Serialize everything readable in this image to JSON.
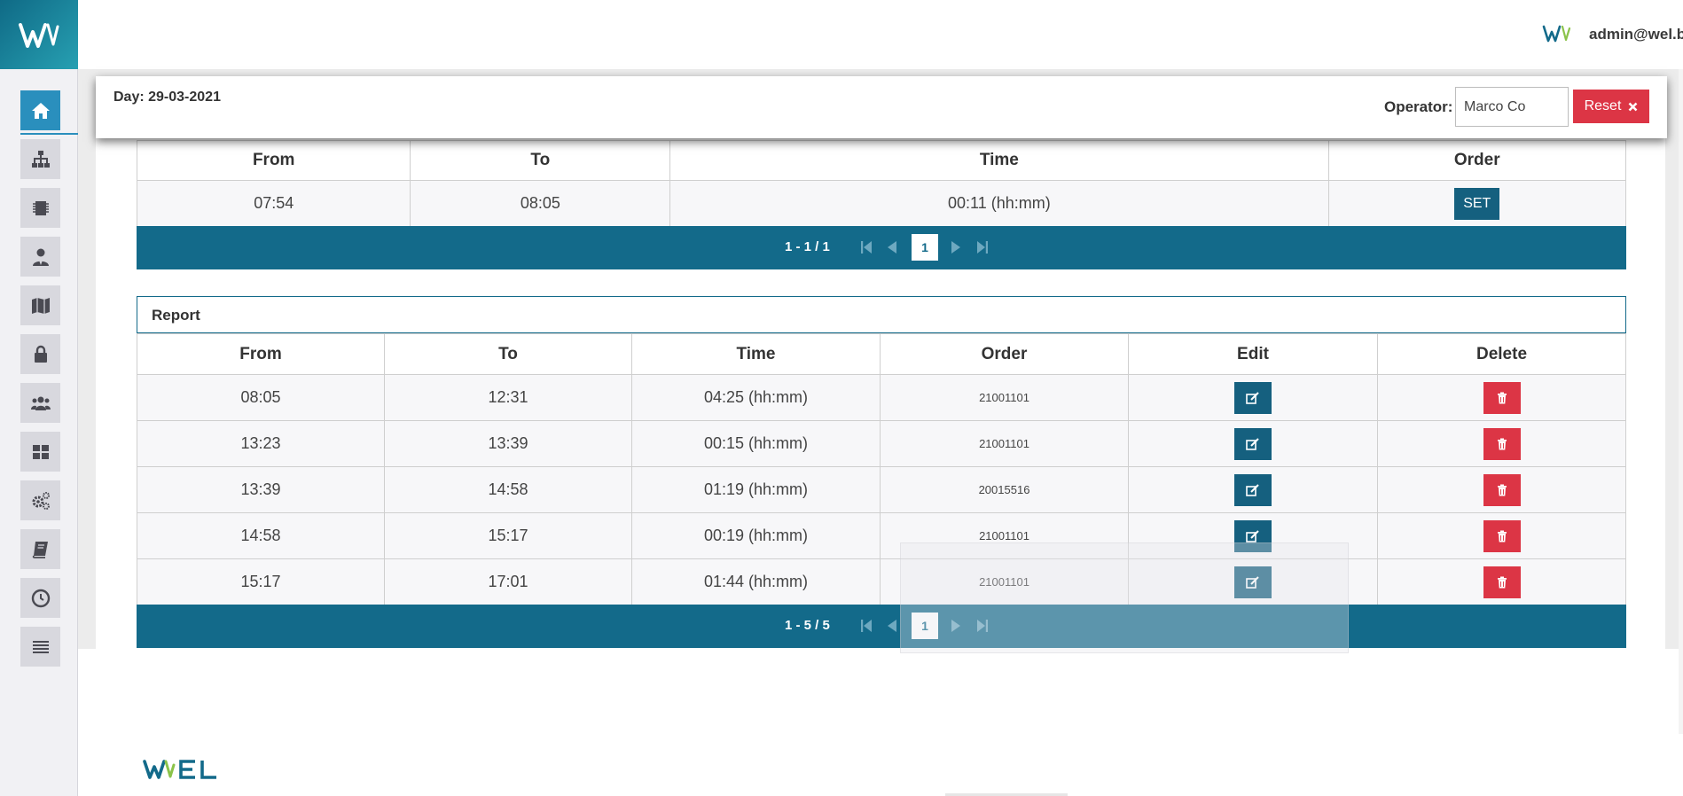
{
  "header": {
    "user_email": "admin@wel.business"
  },
  "sidebar": {
    "items": [
      {
        "name": "home",
        "icon": "home-icon"
      },
      {
        "name": "structure",
        "icon": "sitemap-icon"
      },
      {
        "name": "device",
        "icon": "chip-icon"
      },
      {
        "name": "operator",
        "icon": "user-tie-icon"
      },
      {
        "name": "map",
        "icon": "map-icon"
      },
      {
        "name": "security",
        "icon": "lock-icon"
      },
      {
        "name": "users",
        "icon": "users-icon"
      },
      {
        "name": "dashboard",
        "icon": "grid-icon"
      },
      {
        "name": "settings",
        "icon": "gears-icon"
      },
      {
        "name": "book",
        "icon": "book-icon"
      },
      {
        "name": "history",
        "icon": "clock-icon"
      },
      {
        "name": "list",
        "icon": "bars-icon"
      }
    ]
  },
  "filter": {
    "day_label": "Day: 29-03-2021",
    "operator_label": "Operator:",
    "operator_value": "Marco Co",
    "reset_label": "Reset"
  },
  "current_table": {
    "headers": [
      "From",
      "To",
      "Time",
      "Order"
    ],
    "rows": [
      {
        "from": "07:54",
        "to": "08:05",
        "time": "00:11 (hh:mm)",
        "order_button": "SET"
      }
    ],
    "pager": {
      "range": "1 - 1 / 1",
      "page": "1"
    }
  },
  "report": {
    "title": "Report",
    "headers": [
      "From",
      "To",
      "Time",
      "Order",
      "Edit",
      "Delete"
    ],
    "rows": [
      {
        "from": "08:05",
        "to": "12:31",
        "time": "04:25 (hh:mm)",
        "order": "21001101"
      },
      {
        "from": "13:23",
        "to": "13:39",
        "time": "00:15 (hh:mm)",
        "order": "21001101"
      },
      {
        "from": "13:39",
        "to": "14:58",
        "time": "01:19 (hh:mm)",
        "order": "20015516"
      },
      {
        "from": "14:58",
        "to": "15:17",
        "time": "00:19 (hh:mm)",
        "order": "21001101"
      },
      {
        "from": "15:17",
        "to": "17:01",
        "time": "01:44 (hh:mm)",
        "order": "21001101"
      }
    ],
    "pager": {
      "range": "1 - 5 / 5",
      "page": "1"
    }
  },
  "colors": {
    "brand_teal": "#136a8a",
    "sidebar_active": "#2a8fbd",
    "danger": "#dc3545"
  }
}
